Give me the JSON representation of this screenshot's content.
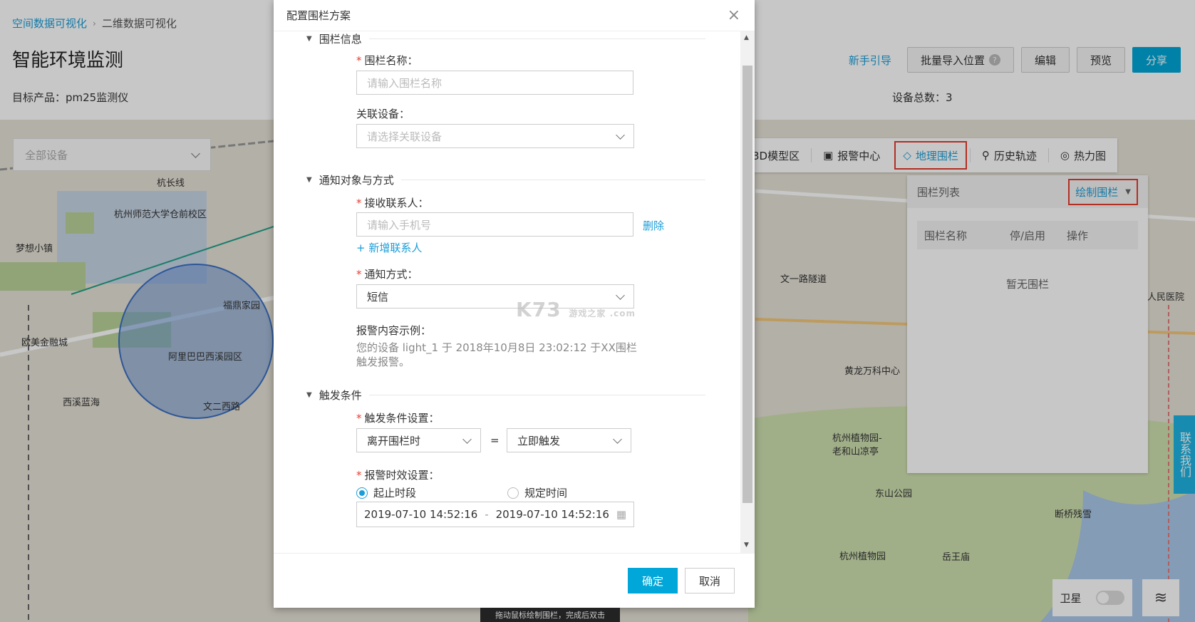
{
  "breadcrumb": {
    "root": "空间数据可视化",
    "sep": "›",
    "current": "二维数据可视化"
  },
  "page": {
    "title": "智能环境监测",
    "product": "目标产品：pm25监测仪",
    "device_total": "设备总数：3"
  },
  "header": {
    "guide": "新手引导",
    "bulk_import": "批量导入位置",
    "help": "?",
    "edit": "编辑",
    "preview": "预览",
    "share": "分享"
  },
  "map": {
    "device_select": "全部设备",
    "toolbar": {
      "model_3d": "3D模型区",
      "alarm": "报警中心",
      "geofence": "地理围栏",
      "history": "历史轨迹",
      "heatmap": "热力图"
    },
    "fence_panel": {
      "title": "围栏列表",
      "draw": "绘制围栏",
      "col_name": "围栏名称",
      "col_toggle": "停/启用",
      "col_action": "操作",
      "empty": "暂无围栏"
    },
    "satellite": "卫星",
    "contact": "联系我们",
    "labels": [
      {
        "text": "杭州师范大学仓前校区"
      },
      {
        "text": "梦想小镇"
      },
      {
        "text": "福鼎家园"
      },
      {
        "text": "欧美金融城"
      },
      {
        "text": "阿里巴巴西溪园区"
      },
      {
        "text": "西溪蓝海"
      },
      {
        "text": "杭长线"
      },
      {
        "text": "文二西路"
      },
      {
        "text": "黄龙万科中心"
      },
      {
        "text": "杭州植物园-老和山凉亭"
      },
      {
        "text": "东山公园"
      },
      {
        "text": "断桥残雪"
      },
      {
        "text": "杭州植物园"
      },
      {
        "text": "岳王庙"
      },
      {
        "text": "人民医院"
      },
      {
        "text": "文一路隧道"
      }
    ]
  },
  "modal": {
    "title": "配置围栏方案",
    "close": "×",
    "sections": {
      "fence_info": "围栏信息",
      "notify": "通知对象与方式",
      "trigger": "触发条件"
    },
    "fence_name_label": "围栏名称：",
    "fence_name_placeholder": "请输入围栏名称",
    "device_label": "关联设备：",
    "device_placeholder": "请选择关联设备",
    "contact_label": "接收联系人：",
    "contact_placeholder": "请输入手机号",
    "delete": "删除",
    "add_contact": "+ 新增联系人",
    "method_label": "通知方式：",
    "method_value": "短信",
    "example_label": "报警内容示例：",
    "example_text": "您的设备 light_1 于 2018年10月8日 23:02:12 于XX围栏触发报警。",
    "trigger_label": "触发条件设置：",
    "trigger_value": "离开围栏时",
    "equals": "=",
    "trigger_action": "立即触发",
    "timing_label": "报警时效设置：",
    "radio_range": "起止时段",
    "radio_fixed": "规定时间",
    "start_time": "2019-07-10 14:52:16",
    "range_sep": "-",
    "end_time": "2019-07-10 14:52:16",
    "ok": "确定",
    "cancel": "取消",
    "watermark": "K73",
    "watermark_sub": "游戏之家 .com"
  },
  "toast": "拖动鼠标绘制围栏，完成后双击"
}
